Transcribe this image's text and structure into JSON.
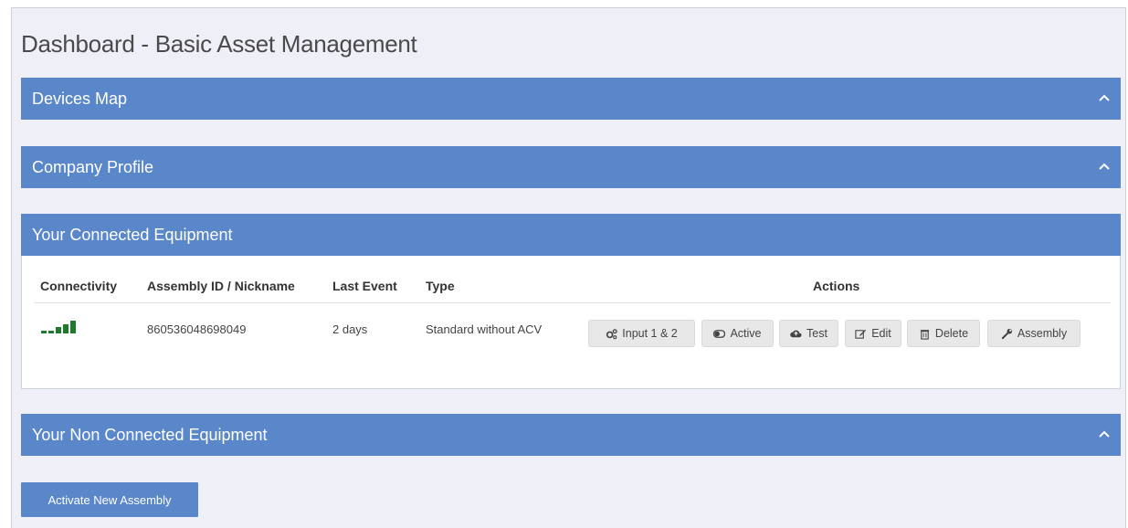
{
  "page": {
    "title": "Dashboard - Basic Asset Management"
  },
  "panels": {
    "devices_map": {
      "label": "Devices Map"
    },
    "company_profile": {
      "label": "Company Profile"
    },
    "connected": {
      "label": "Your Connected Equipment"
    },
    "non_connected": {
      "label": "Your Non Connected Equipment"
    }
  },
  "table": {
    "headers": {
      "connectivity": "Connectivity",
      "assembly": "Assembly ID / Nickname",
      "last_event": "Last Event",
      "type": "Type",
      "actions": "Actions"
    },
    "rows": [
      {
        "signal_bars_filled": 5,
        "assembly": "860536048698049",
        "last_event": "2 days",
        "type": "Standard without ACV",
        "actions": {
          "input": "Input 1 & 2",
          "active": "Active",
          "test": "Test",
          "edit": "Edit",
          "delete": "Delete",
          "assembly": "Assembly"
        }
      }
    ]
  },
  "footer": {
    "activate_label": "Activate New Assembly"
  },
  "colors": {
    "header_blue": "#5a87c9",
    "signal_green": "#1f7a2e"
  },
  "icons": {
    "input": "cogs-icon",
    "active": "toggle-icon",
    "test": "cloud-upload-icon",
    "edit": "edit-icon",
    "delete": "trash-icon",
    "assembly": "wrench-icon",
    "collapse": "chevron-up-icon"
  }
}
